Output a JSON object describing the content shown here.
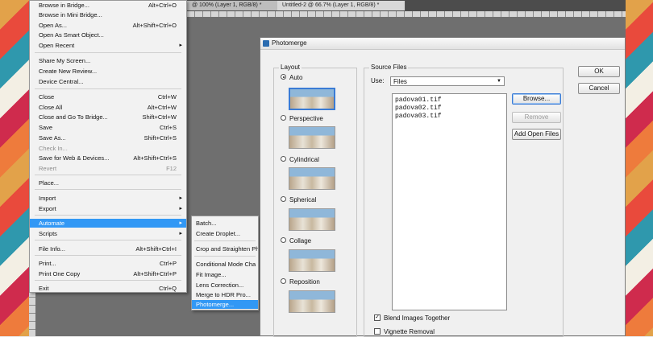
{
  "document_tabs": [
    "@ 100% (Layer 1, RGB/8) *",
    "Untitled-2 @ 66.7% (Layer 1, RGB/8) *"
  ],
  "file_menu": {
    "items": [
      {
        "label": "Browse in Bridge...",
        "shortcut": "Alt+Ctrl+O"
      },
      {
        "label": "Browse in Mini Bridge...",
        "shortcut": ""
      },
      {
        "label": "Open As...",
        "shortcut": "Alt+Shift+Ctrl+O"
      },
      {
        "label": "Open As Smart Object...",
        "shortcut": ""
      },
      {
        "label": "Open Recent",
        "shortcut": ""
      },
      {
        "label": "Share My Screen...",
        "shortcut": ""
      },
      {
        "label": "Create New Review...",
        "shortcut": ""
      },
      {
        "label": "Device Central...",
        "shortcut": ""
      },
      {
        "label": "Close",
        "shortcut": "Ctrl+W"
      },
      {
        "label": "Close All",
        "shortcut": "Alt+Ctrl+W"
      },
      {
        "label": "Close and Go To Bridge...",
        "shortcut": "Shift+Ctrl+W"
      },
      {
        "label": "Save",
        "shortcut": "Ctrl+S"
      },
      {
        "label": "Save As...",
        "shortcut": "Shift+Ctrl+S"
      },
      {
        "label": "Check In...",
        "shortcut": ""
      },
      {
        "label": "Save for Web & Devices...",
        "shortcut": "Alt+Shift+Ctrl+S"
      },
      {
        "label": "Revert",
        "shortcut": "F12"
      },
      {
        "label": "Place...",
        "shortcut": ""
      },
      {
        "label": "Import",
        "shortcut": ""
      },
      {
        "label": "Export",
        "shortcut": ""
      },
      {
        "label": "Automate",
        "shortcut": ""
      },
      {
        "label": "Scripts",
        "shortcut": ""
      },
      {
        "label": "File Info...",
        "shortcut": "Alt+Shift+Ctrl+I"
      },
      {
        "label": "Print...",
        "shortcut": "Ctrl+P"
      },
      {
        "label": "Print One Copy",
        "shortcut": "Alt+Shift+Ctrl+P"
      },
      {
        "label": "Exit",
        "shortcut": "Ctrl+Q"
      }
    ]
  },
  "automate_submenu": {
    "items": [
      "Batch...",
      "Create Droplet...",
      "Crop and Straighten Ph",
      "Conditional Mode Cha",
      "Fit Image...",
      "Lens Correction...",
      "Merge to HDR Pro...",
      "Photomerge..."
    ],
    "selected": "Photomerge..."
  },
  "dialog": {
    "title": "Photomerge",
    "layout_group": "Layout",
    "layout_options": [
      "Auto",
      "Perspective",
      "Cylindrical",
      "Spherical",
      "Collage",
      "Reposition"
    ],
    "layout_selected": "Auto",
    "source_group": "Source Files",
    "use_label": "Use:",
    "use_value": "Files",
    "files": [
      "padova01.tif",
      "padova02.tif",
      "padova03.tif"
    ],
    "browse_label": "Browse...",
    "remove_label": "Remove",
    "add_open_files_label": "Add Open Files",
    "ok_label": "OK",
    "cancel_label": "Cancel",
    "blend_label": "Blend Images Together",
    "blend_checked": true,
    "vignette_label": "Vignette Removal",
    "vignette_checked": false
  },
  "colors": {
    "menu_highlight": "#3298f5",
    "photoshop_workspace": "#6f6f6f"
  }
}
